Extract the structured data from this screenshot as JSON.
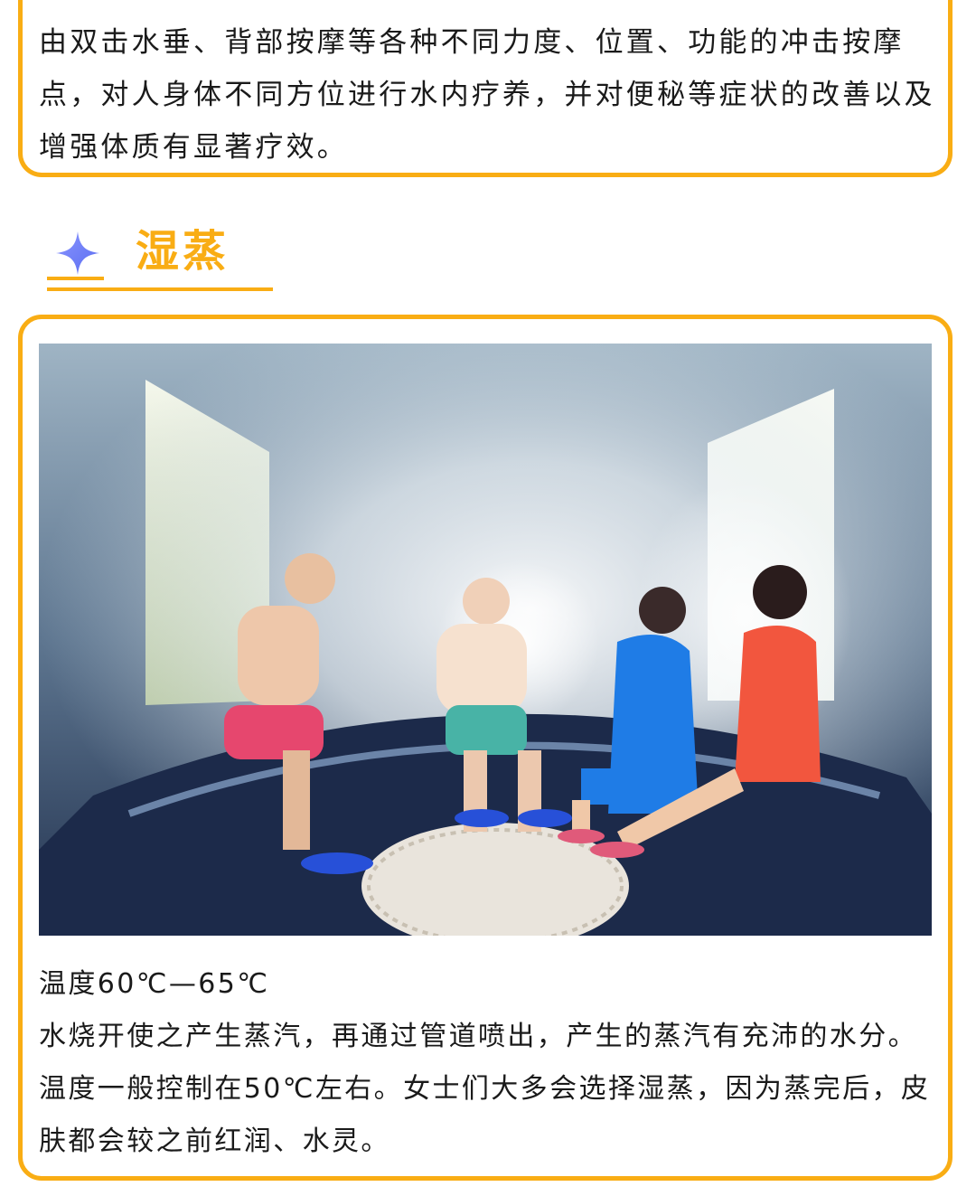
{
  "top_card": {
    "text": "由双击水垂、背部按摩等各种不同力度、位置、功能的冲击按摩点，对人身体不同方位进行水内疗养，并对便秘等症状的改善以及增强体质有显著疗效。"
  },
  "section": {
    "icon": "sparkle-star-icon",
    "title": "湿蒸"
  },
  "photo": {
    "subject": "steam-room-photo"
  },
  "details": {
    "temperature": "温度60℃—65℃",
    "description": "水烧开使之产生蒸汽，再通过管道喷出，产生的蒸汽有充沛的水分。温度一般控制在50℃左右。女士们大多会选择湿蒸，因为蒸完后，皮肤都会较之前红润、水灵。"
  },
  "colors": {
    "accent": "#f9ad14",
    "star": "#6f7ff5"
  }
}
